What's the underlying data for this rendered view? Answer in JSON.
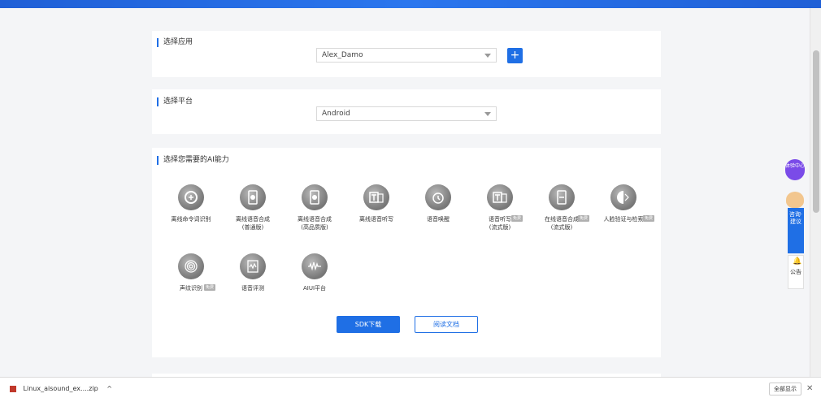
{
  "sections": {
    "app": {
      "title": "选择应用",
      "selected": "Alex_Damo",
      "add_label": "+"
    },
    "platform": {
      "title": "选择平台",
      "selected": "Android"
    },
    "ability": {
      "title": "选择您需要的AI能力",
      "items": [
        {
          "label": "离线命令词识别",
          "badge": ""
        },
        {
          "label": "离线语音合成\n(普通版)",
          "badge": ""
        },
        {
          "label": "离线语音合成\n(高品质版)",
          "badge": ""
        },
        {
          "label": "离线语音听写",
          "badge": ""
        },
        {
          "label": "语音唤醒",
          "badge": ""
        },
        {
          "label": "语音听写\n(流式版)",
          "badge": "免费"
        },
        {
          "label": "在线语音合成\n(流式版)",
          "badge": "免费"
        },
        {
          "label": "人脸验证与检索",
          "badge": "免费"
        },
        {
          "label": "声纹识别",
          "badge": "免费"
        },
        {
          "label": "语音评测",
          "badge": ""
        },
        {
          "label": "AIUI平台",
          "badge": ""
        }
      ],
      "sdk_download": "SDK下载",
      "read_docs": "阅读文档"
    }
  },
  "side": {
    "experience_center": "体验中心",
    "feedback": "咨询·建议",
    "notice": "公告"
  },
  "downloads": {
    "file": "Linux_aisound_ex....zip",
    "show_all": "全部显示",
    "close": "✕"
  },
  "colors": {
    "accent": "#1f6fe5",
    "purple": "#7a4be8"
  }
}
